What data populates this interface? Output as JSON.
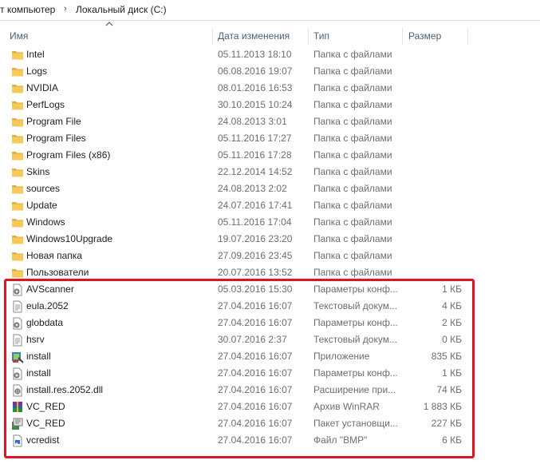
{
  "breadcrumb": {
    "parent": "т компьютер",
    "separator": "›",
    "current": "Локальный диск (C:)"
  },
  "columns": {
    "name": "Имя",
    "date": "Дата изменения",
    "type": "Тип",
    "size": "Размер"
  },
  "files": [
    {
      "name": "Intel",
      "date": "05.11.2013 18:10",
      "type": "Папка с файлами",
      "size": "",
      "icon": "folder-icon"
    },
    {
      "name": "Logs",
      "date": "06.08.2016 19:07",
      "type": "Папка с файлами",
      "size": "",
      "icon": "folder-icon"
    },
    {
      "name": "NVIDIA",
      "date": "08.01.2016 16:53",
      "type": "Папка с файлами",
      "size": "",
      "icon": "folder-icon"
    },
    {
      "name": "PerfLogs",
      "date": "30.10.2015 10:24",
      "type": "Папка с файлами",
      "size": "",
      "icon": "folder-icon"
    },
    {
      "name": "Program File",
      "date": "24.08.2013 3:01",
      "type": "Папка с файлами",
      "size": "",
      "icon": "folder-icon"
    },
    {
      "name": "Program Files",
      "date": "05.11.2016 17:27",
      "type": "Папка с файлами",
      "size": "",
      "icon": "folder-icon"
    },
    {
      "name": "Program Files (x86)",
      "date": "05.11.2016 17:28",
      "type": "Папка с файлами",
      "size": "",
      "icon": "folder-icon"
    },
    {
      "name": "Skins",
      "date": "22.12.2014 14:52",
      "type": "Папка с файлами",
      "size": "",
      "icon": "folder-icon"
    },
    {
      "name": "sources",
      "date": "24.08.2013 2:02",
      "type": "Папка с файлами",
      "size": "",
      "icon": "folder-icon"
    },
    {
      "name": "Update",
      "date": "24.07.2016 17:41",
      "type": "Папка с файлами",
      "size": "",
      "icon": "folder-icon"
    },
    {
      "name": "Windows",
      "date": "05.11.2016 17:04",
      "type": "Папка с файлами",
      "size": "",
      "icon": "folder-icon"
    },
    {
      "name": "Windows10Upgrade",
      "date": "19.07.2016 23:20",
      "type": "Папка с файлами",
      "size": "",
      "icon": "folder-icon"
    },
    {
      "name": "Новая папка",
      "date": "27.09.2016 23:45",
      "type": "Папка с файлами",
      "size": "",
      "icon": "folder-icon"
    },
    {
      "name": "Пользователи",
      "date": "20.07.2016 13:52",
      "type": "Папка с файлами",
      "size": "",
      "icon": "folder-icon"
    },
    {
      "name": "AVScanner",
      "date": "05.03.2016 15:30",
      "type": "Параметры конф...",
      "size": "1 КБ",
      "icon": "settings-file-icon"
    },
    {
      "name": "eula.2052",
      "date": "27.04.2016 16:07",
      "type": "Текстовый докум...",
      "size": "4 КБ",
      "icon": "text-file-icon"
    },
    {
      "name": "globdata",
      "date": "27.04.2016 16:07",
      "type": "Параметры конф...",
      "size": "2 КБ",
      "icon": "settings-file-icon"
    },
    {
      "name": "hsrv",
      "date": "30.07.2016 2:37",
      "type": "Текстовый докум...",
      "size": "0 КБ",
      "icon": "text-file-icon"
    },
    {
      "name": "install",
      "date": "27.04.2016 16:07",
      "type": "Приложение",
      "size": "835 КБ",
      "icon": "installer-icon"
    },
    {
      "name": "install",
      "date": "27.04.2016 16:07",
      "type": "Параметры конф...",
      "size": "1 КБ",
      "icon": "settings-file-icon"
    },
    {
      "name": "install.res.2052.dll",
      "date": "27.04.2016 16:07",
      "type": "Расширение при...",
      "size": "74 КБ",
      "icon": "dll-file-icon"
    },
    {
      "name": "VC_RED",
      "date": "27.04.2016 16:07",
      "type": "Архив WinRAR",
      "size": "1 883 КБ",
      "icon": "winrar-archive-icon"
    },
    {
      "name": "VC_RED",
      "date": "27.04.2016 16:07",
      "type": "Пакет установщи...",
      "size": "227 КБ",
      "icon": "msi-package-icon"
    },
    {
      "name": "vcredist",
      "date": "27.04.2016 16:07",
      "type": "Файл \"BMP\"",
      "size": "6 КБ",
      "icon": "bmp-image-icon"
    }
  ],
  "colors": {
    "highlight": "#e0141e",
    "folder": "#f5c95a",
    "header_text": "#4c607a",
    "secondary_text": "#6d6d6d"
  }
}
